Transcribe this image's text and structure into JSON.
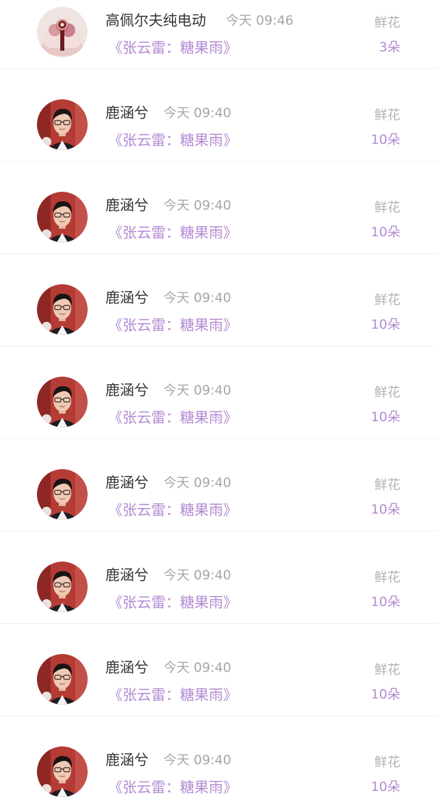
{
  "colors": {
    "accent": "#b38ad3",
    "name_text": "#333333",
    "muted_text": "#a6a6a6",
    "divider": "#f1f1f1"
  },
  "gifts": [
    {
      "user": "高佩尔夫纯电动",
      "time": "今天 09:46",
      "work": "《张云雷：糖果雨》",
      "gift_type": "鲜花",
      "count": "3朵",
      "avatar": "flower-cake-avatar"
    },
    {
      "user": "鹿涵兮",
      "time": "今天 09:40",
      "work": "《张云雷：糖果雨》",
      "gift_type": "鲜花",
      "count": "10朵",
      "avatar": "man-portrait-avatar"
    },
    {
      "user": "鹿涵兮",
      "time": "今天 09:40",
      "work": "《张云雷：糖果雨》",
      "gift_type": "鲜花",
      "count": "10朵",
      "avatar": "man-portrait-avatar"
    },
    {
      "user": "鹿涵兮",
      "time": "今天 09:40",
      "work": "《张云雷：糖果雨》",
      "gift_type": "鲜花",
      "count": "10朵",
      "avatar": "man-portrait-avatar"
    },
    {
      "user": "鹿涵兮",
      "time": "今天 09:40",
      "work": "《张云雷：糖果雨》",
      "gift_type": "鲜花",
      "count": "10朵",
      "avatar": "man-portrait-avatar"
    },
    {
      "user": "鹿涵兮",
      "time": "今天 09:40",
      "work": "《张云雷：糖果雨》",
      "gift_type": "鲜花",
      "count": "10朵",
      "avatar": "man-portrait-avatar"
    },
    {
      "user": "鹿涵兮",
      "time": "今天 09:40",
      "work": "《张云雷：糖果雨》",
      "gift_type": "鲜花",
      "count": "10朵",
      "avatar": "man-portrait-avatar"
    },
    {
      "user": "鹿涵兮",
      "time": "今天 09:40",
      "work": "《张云雷：糖果雨》",
      "gift_type": "鲜花",
      "count": "10朵",
      "avatar": "man-portrait-avatar"
    },
    {
      "user": "鹿涵兮",
      "time": "今天 09:40",
      "work": "《张云雷：糖果雨》",
      "gift_type": "鲜花",
      "count": "10朵",
      "avatar": "man-portrait-avatar"
    }
  ]
}
